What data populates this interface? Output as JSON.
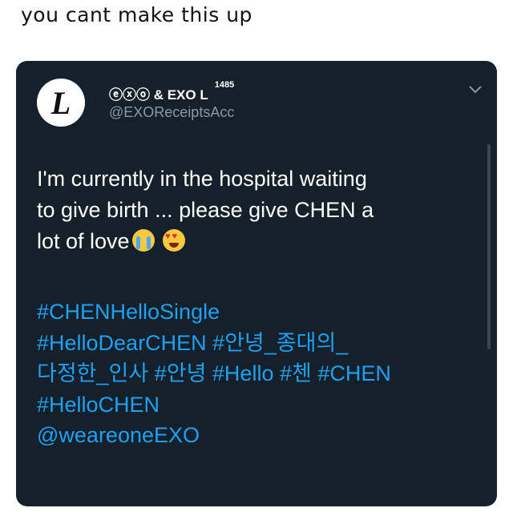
{
  "caption": "you cant make this up",
  "tweet": {
    "avatar_letter": "L",
    "display_name": "ⓔⓧⓞ & EXO L",
    "name_superscript": "1485",
    "handle": "@EXOReceiptsAcc",
    "text_line_1": "I'm currently in the hospital waiting",
    "text_line_2": "to give birth ... please give CHEN a",
    "text_line_3": "lot of love",
    "emojis": [
      "loudly-crying-face-emoji",
      "heart-eyes-emoji"
    ],
    "tag_lines": [
      "#CHENHelloSingle",
      "#HelloDearCHEN #안녕_종대의_",
      "다정한_인사 #안녕 #Hello #첸 #CHEN",
      "#HelloCHEN",
      "@weareoneEXO"
    ]
  },
  "colors": {
    "card_background": "#15202b",
    "link": "#1da1f2",
    "secondary_text": "#8899a6"
  }
}
